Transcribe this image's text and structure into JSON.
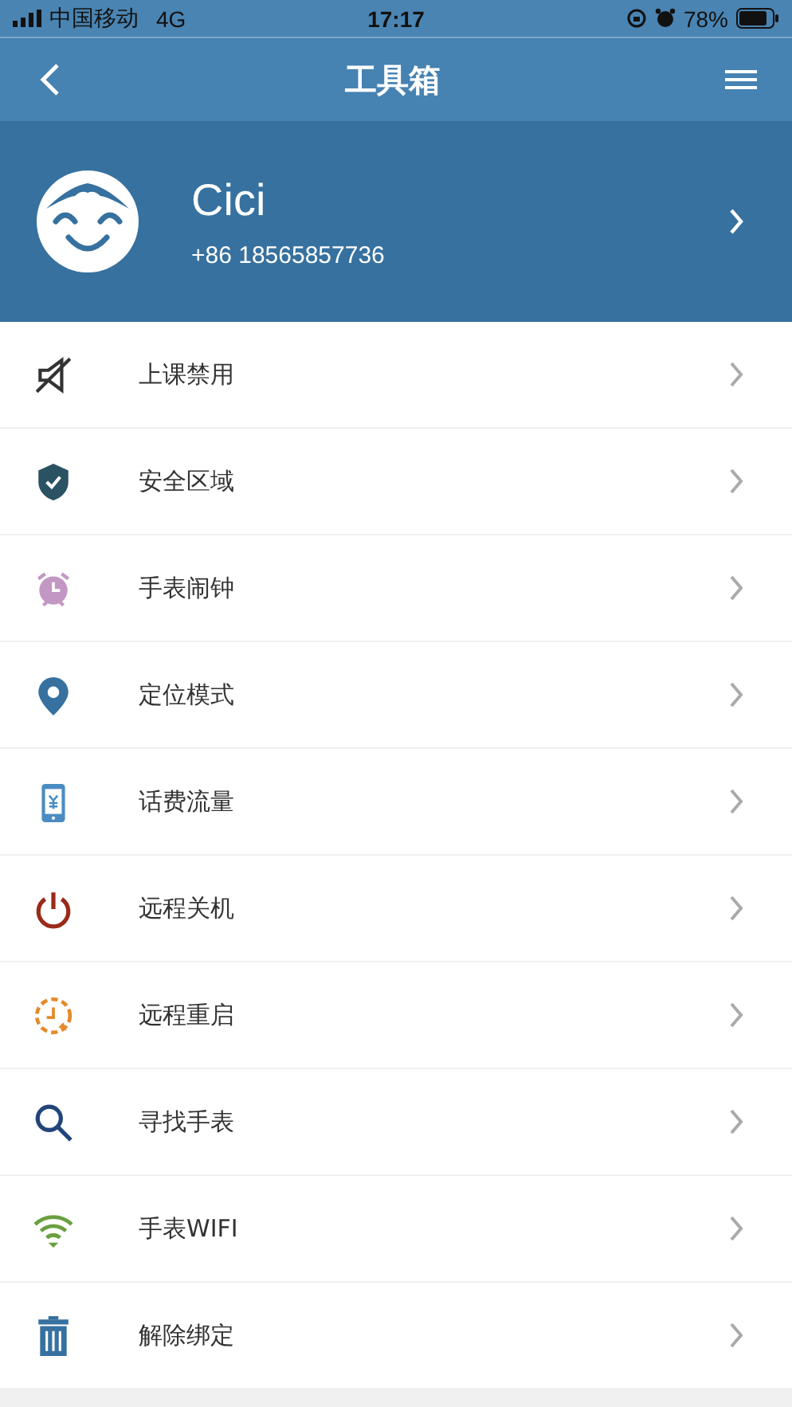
{
  "status_bar": {
    "carrier": "中国移动",
    "network": "4G",
    "time": "17:17",
    "battery": "78%"
  },
  "nav": {
    "title": "工具箱"
  },
  "profile": {
    "name": "Cici",
    "phone": "+86 18565857736"
  },
  "tools": [
    {
      "label": "上课禁用"
    },
    {
      "label": "安全区域"
    },
    {
      "label": "手表闹钟"
    },
    {
      "label": "定位模式"
    },
    {
      "label": "话费流量"
    },
    {
      "label": "远程关机"
    },
    {
      "label": "远程重启"
    },
    {
      "label": "寻找手表"
    },
    {
      "label": "手表WIFI"
    },
    {
      "label": "解除绑定"
    }
  ]
}
